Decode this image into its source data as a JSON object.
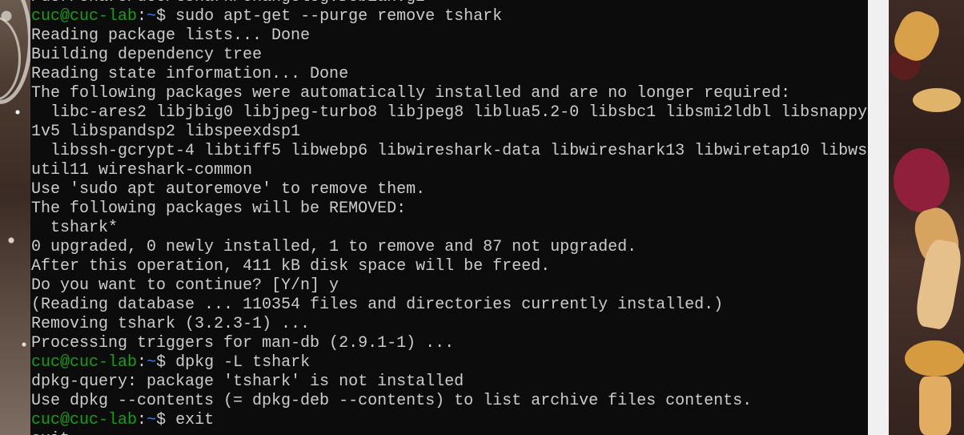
{
  "prompt": {
    "user_host": "cuc@cuc-lab",
    "colon": ":",
    "path": "~",
    "symbol": "$ "
  },
  "terminal": {
    "top_partial_line": "/usr/share/doc/tshark/changelog.Debian.gz",
    "command_1": "sudo apt-get --purge remove tshark",
    "output_1": [
      "Reading package lists... Done",
      "Building dependency tree",
      "Reading state information... Done",
      "The following packages were automatically installed and are no longer required:",
      "  libc-ares2 libjbig0 libjpeg-turbo8 libjpeg8 liblua5.2-0 libsbc1 libsmi2ldbl libsnappy",
      "1v5 libspandsp2 libspeexdsp1",
      "  libssh-gcrypt-4 libtiff5 libwebp6 libwireshark-data libwireshark13 libwiretap10 libws",
      "util11 wireshark-common",
      "Use 'sudo apt autoremove' to remove them.",
      "The following packages will be REMOVED:",
      "  tshark*",
      "0 upgraded, 0 newly installed, 1 to remove and 87 not upgraded.",
      "After this operation, 411 kB disk space will be freed.",
      "Do you want to continue? [Y/n] y",
      "(Reading database ... 110354 files and directories currently installed.)",
      "Removing tshark (3.2.3-1) ...",
      "Processing triggers for man-db (2.9.1-1) ..."
    ],
    "command_2": "dpkg -L tshark",
    "output_2": [
      "dpkg-query: package 'tshark' is not installed",
      "Use dpkg --contents (= dpkg-deb --contents) to list archive files contents."
    ],
    "command_3": "exit",
    "bottom_partial_line": "exit"
  }
}
